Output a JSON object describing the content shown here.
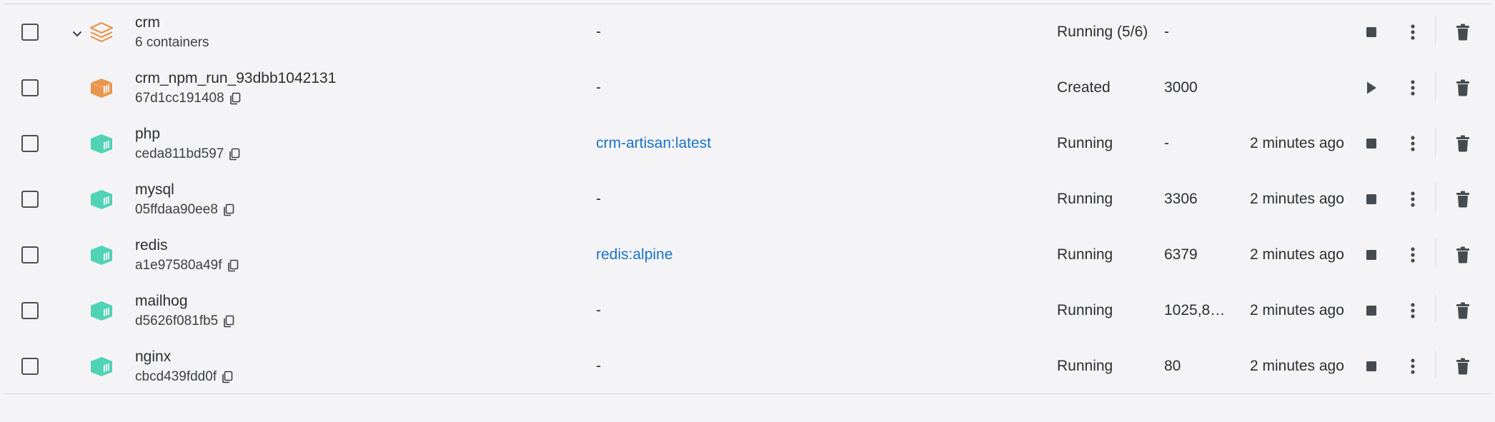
{
  "colors": {
    "background": "#f4f4f6",
    "link": "#1a73c7",
    "compose_icon": "#e8964e",
    "created_container": "#e8964e",
    "running_container": "#4fd2b6",
    "action_icon": "#464a51"
  },
  "group": {
    "name": "crm",
    "subtitle": "6 containers",
    "image": "-",
    "status": "Running (5/6)",
    "port": "-",
    "started": "",
    "action": "stop"
  },
  "containers": [
    {
      "name": "crm_npm_run_93dbb1042131",
      "id": "67d1cc191408",
      "image": "-",
      "image_is_link": false,
      "status": "Created",
      "port": "3000",
      "started": "",
      "action": "start",
      "icon_color": "#e8964e"
    },
    {
      "name": "php",
      "id": "ceda811bd597",
      "image": "crm-artisan:latest",
      "image_is_link": true,
      "status": "Running",
      "port": "-",
      "started": "2 minutes ago",
      "action": "stop",
      "icon_color": "#4fd2b6"
    },
    {
      "name": "mysql",
      "id": "05ffdaa90ee8",
      "image": "-",
      "image_is_link": false,
      "status": "Running",
      "port": "3306",
      "started": "2 minutes ago",
      "action": "stop",
      "icon_color": "#4fd2b6"
    },
    {
      "name": "redis",
      "id": "a1e97580a49f",
      "image": "redis:alpine",
      "image_is_link": true,
      "status": "Running",
      "port": "6379",
      "started": "2 minutes ago",
      "action": "stop",
      "icon_color": "#4fd2b6"
    },
    {
      "name": "mailhog",
      "id": "d5626f081fb5",
      "image": "-",
      "image_is_link": false,
      "status": "Running",
      "port": "1025,8…",
      "started": "2 minutes ago",
      "action": "stop",
      "icon_color": "#4fd2b6"
    },
    {
      "name": "nginx",
      "id": "cbcd439fdd0f",
      "image": "-",
      "image_is_link": false,
      "status": "Running",
      "port": "80",
      "started": "2 minutes ago",
      "action": "stop",
      "icon_color": "#4fd2b6"
    }
  ]
}
